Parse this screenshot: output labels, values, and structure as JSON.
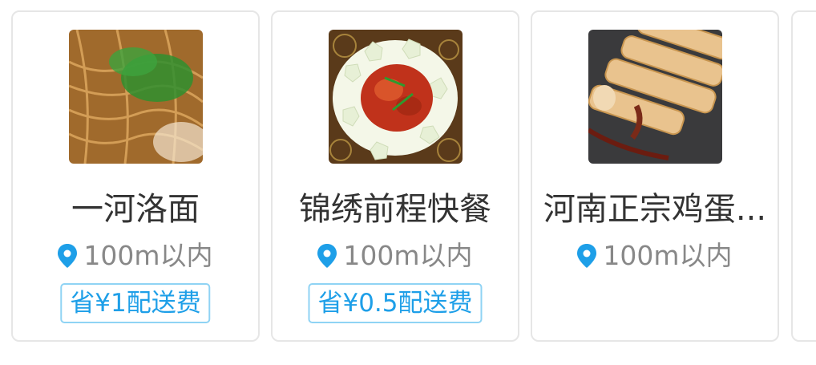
{
  "accent_color": "#1e9fe8",
  "shops": [
    {
      "name": "一河洛面",
      "distance": "100m以内",
      "discount": "省¥1配送费",
      "image": "noodle-dish-photo"
    },
    {
      "name": "锦绣前程快餐",
      "distance": "100m以内",
      "discount": "省¥0.5配送费",
      "image": "stir-fry-dish-photo"
    },
    {
      "name": "河南正宗鸡蛋...",
      "distance": "100m以内",
      "discount": "",
      "image": "egg-roll-dish-photo"
    }
  ],
  "icons": {
    "location": "location-pin-icon"
  }
}
